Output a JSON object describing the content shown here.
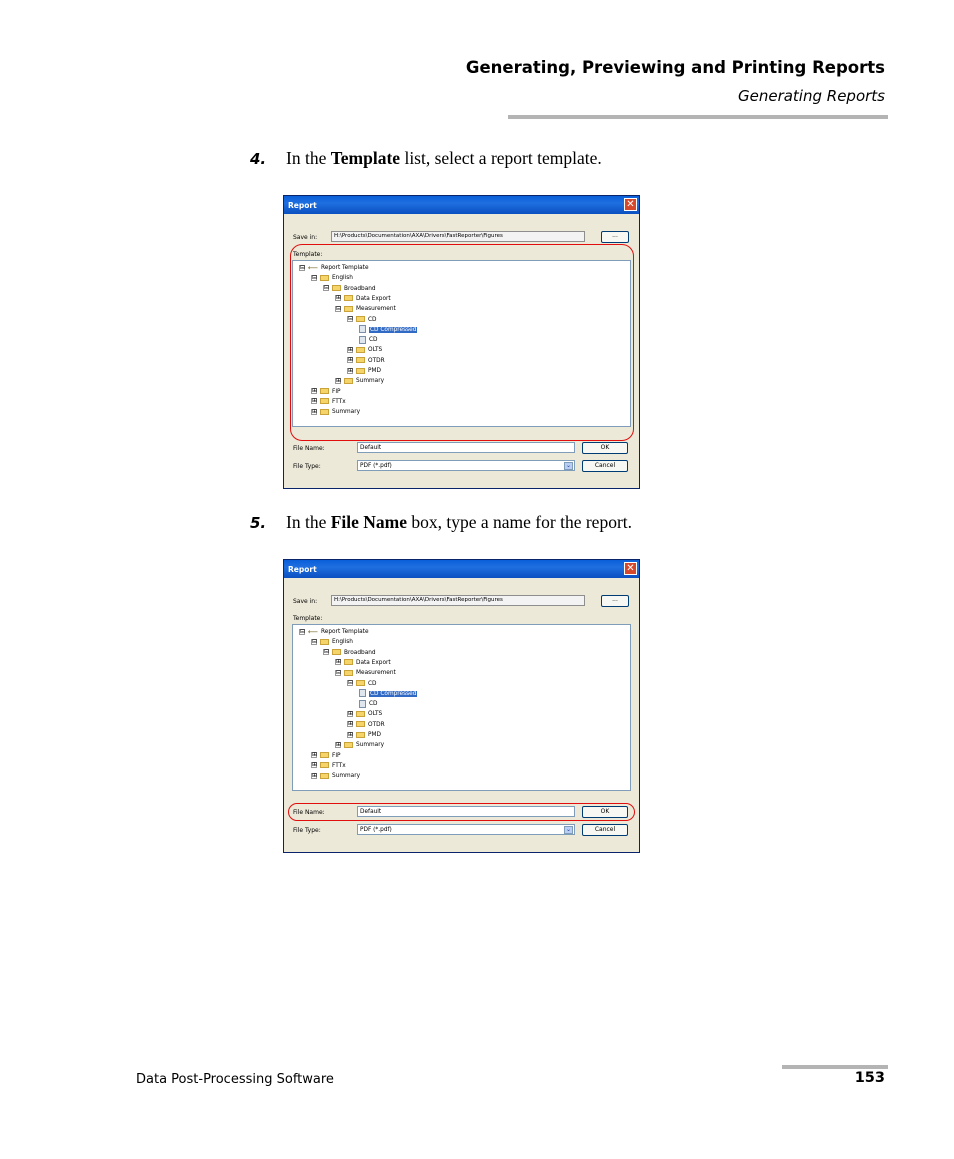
{
  "header": {
    "title": "Generating, Previewing and Printing Reports",
    "subtitle": "Generating Reports"
  },
  "steps": [
    {
      "number": "4.",
      "pre": "In the ",
      "bold": "Template",
      "post": " list, select a report template."
    },
    {
      "number": "5.",
      "pre": "In the ",
      "bold": "File Name",
      "post": " box, type a name for the report."
    }
  ],
  "dialog": {
    "title": "Report",
    "close_glyph": "✕",
    "save_in_label": "Save in:",
    "save_in_path": "H:\\Products\\Documentation\\AXA\\Drivers\\FastReporter\\Figures",
    "browse_label": "...",
    "template_label": "Template:",
    "tree": [
      {
        "label": "Report Template",
        "kind": "root",
        "exp": "⊟"
      },
      {
        "label": "English",
        "kind": "folder",
        "exp": "⊟"
      },
      {
        "label": "Broadband",
        "kind": "folder",
        "exp": "⊟"
      },
      {
        "label": "Data Export",
        "kind": "folder",
        "exp": "⊞"
      },
      {
        "label": "Measurement",
        "kind": "folder",
        "exp": "⊟"
      },
      {
        "label": "CD",
        "kind": "folder",
        "exp": "⊟"
      },
      {
        "label": "CD Compressed",
        "kind": "doc",
        "exp": "",
        "selected": true
      },
      {
        "label": "CD",
        "kind": "doc",
        "exp": ""
      },
      {
        "label": "OLTS",
        "kind": "folder",
        "exp": "⊞"
      },
      {
        "label": "OTDR",
        "kind": "folder",
        "exp": "⊞"
      },
      {
        "label": "PMD",
        "kind": "folder",
        "exp": "⊞"
      },
      {
        "label": "Summary",
        "kind": "folder",
        "exp": "⊞"
      },
      {
        "label": "FIP",
        "kind": "folder",
        "exp": "⊞"
      },
      {
        "label": "FTTx",
        "kind": "folder",
        "exp": "⊞"
      },
      {
        "label": "Summary",
        "kind": "folder",
        "exp": "⊞"
      }
    ],
    "file_name_label": "File Name:",
    "file_name_value": "Default",
    "file_type_label": "File Type:",
    "file_type_value": "PDF (*.pdf)",
    "dropdown_glyph": "⌄",
    "ok_label": "OK",
    "cancel_label": "Cancel"
  },
  "footer": {
    "left": "Data Post-Processing Software",
    "page": "153"
  },
  "colors": {
    "highlight": "#e20d0d",
    "titlebar": "#0a5fd8",
    "selection": "#316ac5"
  }
}
